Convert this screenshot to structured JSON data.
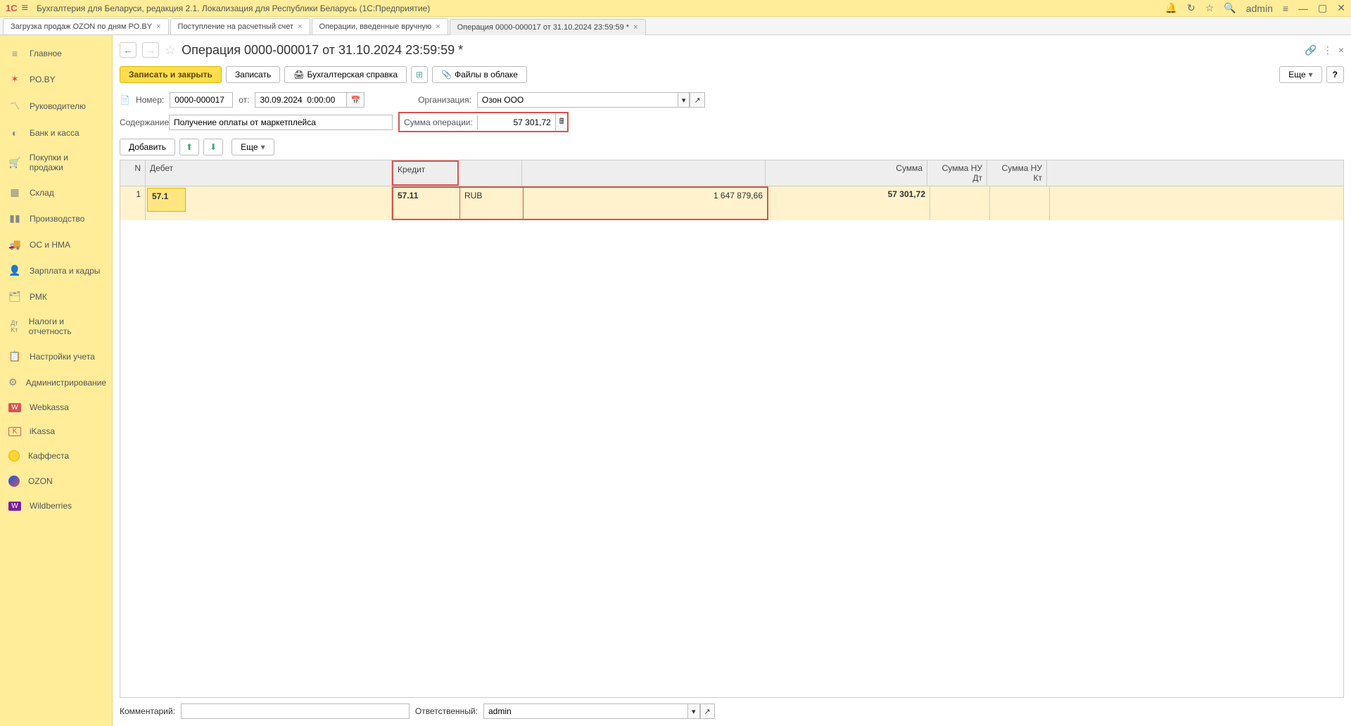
{
  "app": {
    "title": "Бухгалтерия для Беларуси, редакция 2.1. Локализация для Республики Беларусь   (1С:Предприятие)",
    "user": "admin"
  },
  "tabs": [
    {
      "label": "Загрузка продаж OZON по дням PO.BY"
    },
    {
      "label": "Поступление на расчетный счет"
    },
    {
      "label": "Операции, введенные вручную"
    },
    {
      "label": "Операция 0000-000017 от 31.10.2024 23:59:59 *",
      "active": true
    }
  ],
  "sidebar": [
    {
      "icon": "≡",
      "label": "Главное"
    },
    {
      "icon": "✶",
      "label": "PO.BY"
    },
    {
      "icon": "📈",
      "label": "Руководителю"
    },
    {
      "icon": "◐",
      "label": "Банк и касса"
    },
    {
      "icon": "🛒",
      "label": "Покупки и продажи"
    },
    {
      "icon": "▦",
      "label": "Склад"
    },
    {
      "icon": "📊",
      "label": "Производство"
    },
    {
      "icon": "🚚",
      "label": "ОС и НМА"
    },
    {
      "icon": "👤",
      "label": "Зарплата и кадры"
    },
    {
      "icon": "🗂",
      "label": "РМК"
    },
    {
      "icon": "Дт",
      "label": "Налоги и отчетность"
    },
    {
      "icon": "📋",
      "label": "Настройки учета"
    },
    {
      "icon": "⚙",
      "label": "Администрирование"
    },
    {
      "icon": "W",
      "label": "Webkassa",
      "color": "#d9534f"
    },
    {
      "icon": "K",
      "label": "iKassa",
      "color": "#d9534f"
    },
    {
      "icon": "●",
      "label": "Каффеста",
      "color": "#ffd633"
    },
    {
      "icon": "◯",
      "label": "OZON",
      "color": "#005bff"
    },
    {
      "icon": "W",
      "label": "Wildberries",
      "color": "#7b1fa2"
    }
  ],
  "page": {
    "title": "Операция 0000-000017 от 31.10.2024 23:59:59 *"
  },
  "toolbar": {
    "save_close": "Записать и закрыть",
    "save": "Записать",
    "account_ref": "Бухгалтерская справка",
    "files": "Файлы в облаке",
    "more": "Еще"
  },
  "form": {
    "number_label": "Номер:",
    "number": "0000-000017",
    "date_label": "от:",
    "date": "30.09.2024  0:00:00",
    "org_label": "Организация:",
    "org": "Озон ООО",
    "desc_label": "Содержание:",
    "desc": "Получение оплаты от маркетплейса",
    "sum_label": "Сумма операции:",
    "sum": "57 301,72"
  },
  "table_toolbar": {
    "add": "Добавить",
    "more": "Еще"
  },
  "table": {
    "headers": {
      "n": "N",
      "debit": "Дебет",
      "credit": "Кредит",
      "sum": "Сумма",
      "nu_dt": "Сумма НУ Дт",
      "nu_kt": "Сумма НУ Кт"
    },
    "rows": [
      {
        "n": "1",
        "debit": "57.1",
        "credit": "57.11",
        "currency": "RUB",
        "cur_amount": "1 647 879,66",
        "sum": "57 301,72",
        "nu_dt": "",
        "nu_kt": ""
      }
    ]
  },
  "footer": {
    "comment_label": "Комментарий:",
    "comment": "",
    "responsible_label": "Ответственный:",
    "responsible": "admin"
  }
}
